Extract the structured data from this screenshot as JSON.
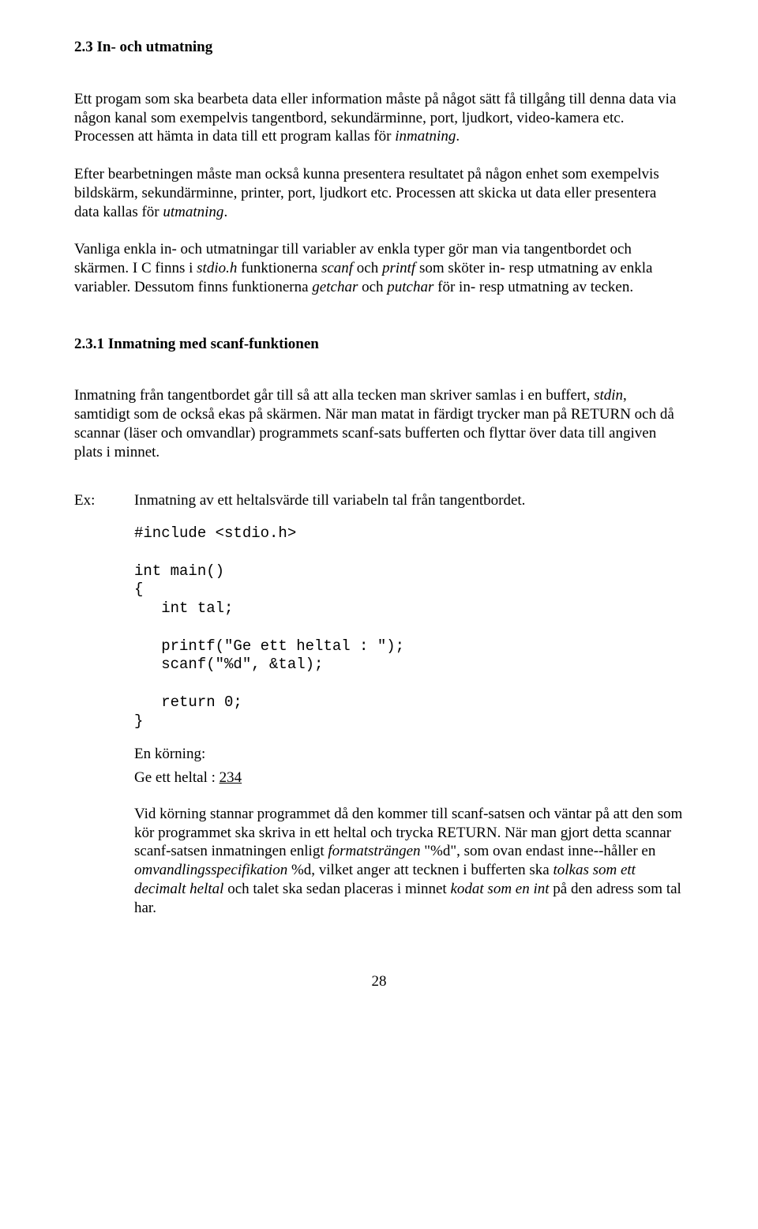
{
  "h1": "2.3 In- och utmatning",
  "p1_a": "Ett progam som ska bearbeta data eller information måste på något sätt få tillgång till denna data via någon kanal som exempelvis tangentbord, sekundärminne, port, ljudkort, video-kamera etc. Processen att hämta in data till ett program kallas för ",
  "p1_i1": "inmatning",
  "p1_b": ".",
  "p2_a": "Efter bearbetningen måste man också kunna presentera resultatet på någon enhet som exempelvis bildskärm, sekundärminne, printer, port, ljudkort etc. Processen att skicka ut data eller presentera data kallas för ",
  "p2_i1": "utmatning",
  "p2_b": ".",
  "p3_a": "Vanliga enkla in- och utmatningar till variabler av enkla typer gör man via tangentbordet och skärmen. I C finns i ",
  "p3_i1": "stdio.h",
  "p3_b": " funktionerna ",
  "p3_i2": "scanf",
  "p3_c": " och ",
  "p3_i3": "printf",
  "p3_d": " som sköter in- resp utmatning av enkla variabler. Dessutom finns funktionerna ",
  "p3_i4": "getchar",
  "p3_e": " och ",
  "p3_i5": "putchar",
  "p3_f": " för in- resp utmatning av tecken.",
  "h2": "2.3.1 Inmatning med scanf-funktionen",
  "p4_a": "Inmatning från tangentbordet går till så att alla tecken man skriver samlas i en buffert, ",
  "p4_i1": "stdin",
  "p4_b": ", samtidigt som de också ekas på skärmen. När man matat in färdigt trycker man på RETURN och då scannar (läser och omvandlar) programmets scanf-sats bufferten och flyttar över data till angiven plats i minnet.",
  "ex_label": "Ex:",
  "ex_text": "Inmatning av ett heltalsvärde till variabeln tal från tangentbordet.",
  "code": "#include <stdio.h>\n\nint main()\n{\n   int tal;\n\n   printf(\"Ge ett heltal : \");\n   scanf(\"%d\", &tal);\n\n   return 0;\n}",
  "run_label": "En körning:",
  "run_prefix": "Ge ett heltal : ",
  "run_value": "234",
  "p5_a": "Vid körning stannar programmet då den kommer till scanf-satsen och väntar på att den som kör programmet ska skriva in ett heltal och trycka RETURN. När man gjort detta scannar scanf-satsen inmatningen enligt ",
  "p5_i1": "formatsträngen",
  "p5_b": " \"%d\", som ovan endast inne--håller en ",
  "p5_i2": "omvandlingsspecifikation",
  "p5_c": " %d, vilket anger att tecknen i bufferten ska ",
  "p5_i3": "tolkas som ett decimalt heltal",
  "p5_d": " och talet ska sedan placeras i minnet ",
  "p5_i4": "kodat som en int",
  "p5_e": " på  den adress som tal har.",
  "page_number": "28"
}
